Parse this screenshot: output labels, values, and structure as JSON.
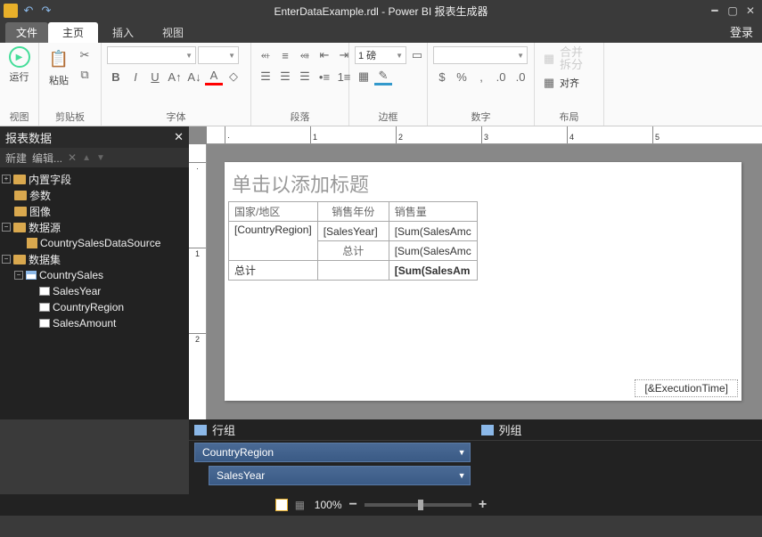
{
  "title": "EnterDataExample.rdl - Power BI 报表生成器",
  "tabs": {
    "file": "文件",
    "home": "主页",
    "insert": "插入",
    "view": "视图"
  },
  "login": "登录",
  "ribbon": {
    "run": "运行",
    "view": "视图",
    "paste": "粘贴",
    "clipboard": "剪贴板",
    "font": "字体",
    "paragraph": "段落",
    "border": "边框",
    "number": "数字",
    "border_width": "1 磅",
    "merge": "合并",
    "split": "拆分",
    "align": "对齐",
    "layout": "布局"
  },
  "panel": {
    "title": "报表数据",
    "new": "新建",
    "edit": "编辑...",
    "builtin": "内置字段",
    "params": "参数",
    "images": "图像",
    "datasources": "数据源",
    "ds1": "CountrySalesDataSource",
    "datasets": "数据集",
    "dset1": "CountrySales",
    "f1": "SalesYear",
    "f2": "CountryRegion",
    "f3": "SalesAmount"
  },
  "canvas": {
    "title_ph": "单击以添加标题",
    "h1": "国家/地区",
    "h2": "销售年份",
    "h3": "销售量",
    "c1": "[CountryRegion]",
    "c2": "[SalesYear]",
    "c3": "[Sum(SalesAmc",
    "g1": "总计",
    "g2": "[Sum(SalesAmc",
    "t1": "总计",
    "t2": "[Sum(SalesAm",
    "exec": "[&ExecutionTime]"
  },
  "groups": {
    "row": "行组",
    "col": "列组",
    "r1": "CountryRegion",
    "r2": "SalesYear"
  },
  "status": {
    "zoom": "100%"
  }
}
